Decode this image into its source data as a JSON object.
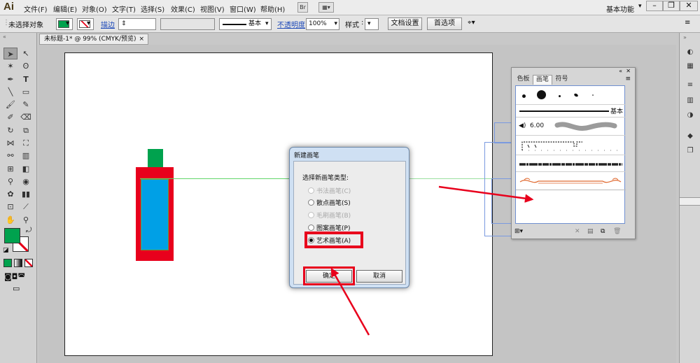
{
  "app": {
    "logo": "Ai"
  },
  "menu": [
    "文件(F)",
    "编辑(E)",
    "对象(O)",
    "文字(T)",
    "选择(S)",
    "效果(C)",
    "视图(V)",
    "窗口(W)",
    "帮助(H)"
  ],
  "menubar_extra": {
    "bridge": "Br"
  },
  "workspace": {
    "label": "基本功能"
  },
  "control_bar": {
    "selection_status": "未选择对象",
    "stroke_label": "描边",
    "brush_basic": "基本",
    "opacity_label": "不透明度",
    "opacity_value": "100%",
    "style_label": "样式",
    "doc_setup": "文档设置",
    "preferences": "首选项"
  },
  "document": {
    "tab_title": "未标题-1* @ 99% (CMYK/预览)",
    "close": "×"
  },
  "colors": {
    "fill": "#00a24e",
    "bottle_red": "#e8001c",
    "bottle_blue": "#00a0e6",
    "highlight_red": "#e8001c",
    "accent": "#1c48b8"
  },
  "brushes_panel": {
    "tabs": [
      "色板",
      "画笔",
      "符号"
    ],
    "active_tab": "画笔",
    "basic_label": "基本",
    "size_label": "6.00"
  },
  "dialog": {
    "title": "新建画笔",
    "prompt": "选择新画笔类型:",
    "options": [
      {
        "label": "书法画笔(C)",
        "enabled": false,
        "selected": false
      },
      {
        "label": "散点画笔(S)",
        "enabled": true,
        "selected": false
      },
      {
        "label": "毛刷画笔(B)",
        "enabled": false,
        "selected": false
      },
      {
        "label": "图案画笔(P)",
        "enabled": true,
        "selected": false
      },
      {
        "label": "艺术画笔(A)",
        "enabled": true,
        "selected": true
      }
    ],
    "ok": "确定",
    "cancel": "取消"
  }
}
